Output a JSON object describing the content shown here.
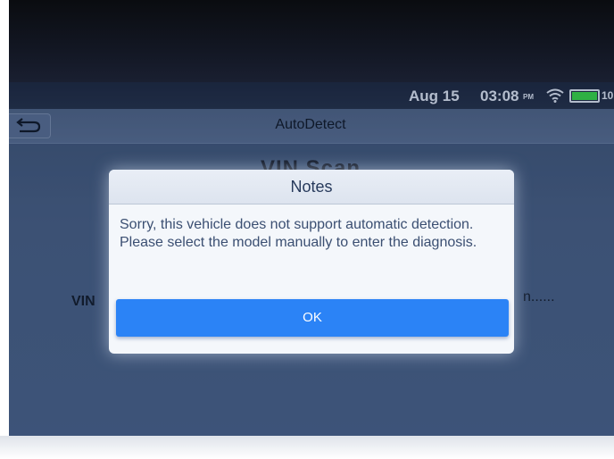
{
  "status_bar": {
    "date": "Aug 15",
    "time": "03:08",
    "ampm": "PM",
    "battery_text": "10",
    "icons": [
      "wifi-icon",
      "battery-icon"
    ],
    "battery_color": "#39e04a"
  },
  "header": {
    "title": "AutoDetect",
    "back_icon": "back-arrow-icon"
  },
  "main": {
    "title": "VIN Scan",
    "vin_label": "VIN",
    "status_text": "n......"
  },
  "dialog": {
    "title": "Notes",
    "message": "Sorry, this vehicle does not support automatic detection. Please select the model manually to enter the diagnosis.",
    "ok_label": "OK",
    "accent_color": "#2b83f6"
  }
}
